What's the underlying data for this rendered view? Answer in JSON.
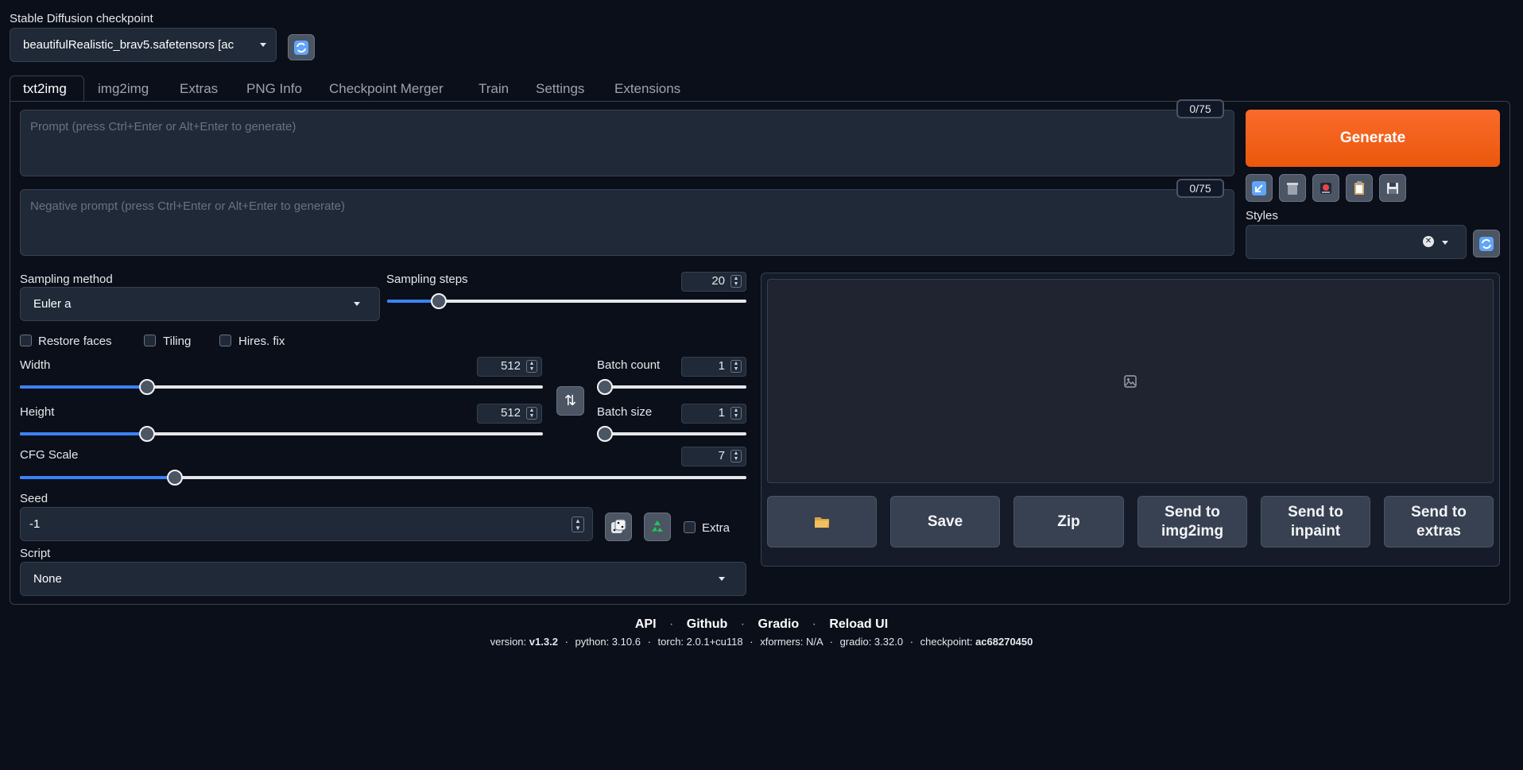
{
  "checkpoint": {
    "label": "Stable Diffusion checkpoint",
    "value": "beautifulRealistic_brav5.safetensors [ac"
  },
  "tabs": [
    "txt2img",
    "img2img",
    "Extras",
    "PNG Info",
    "Checkpoint Merger",
    "Train",
    "Settings",
    "Extensions"
  ],
  "prompt": {
    "placeholder": "Prompt (press Ctrl+Enter or Alt+Enter to generate)",
    "counter": "0/75"
  },
  "negative_prompt": {
    "placeholder": "Negative prompt (press Ctrl+Enter or Alt+Enter to generate)",
    "counter": "0/75"
  },
  "generate_label": "Generate",
  "styles_label": "Styles",
  "sampling": {
    "method_label": "Sampling method",
    "method_value": "Euler a",
    "steps_label": "Sampling steps",
    "steps_value": "20"
  },
  "checkboxes": {
    "restore_faces": "Restore faces",
    "tiling": "Tiling",
    "hires_fix": "Hires. fix",
    "extra": "Extra"
  },
  "width": {
    "label": "Width",
    "value": "512",
    "level": 0.2353
  },
  "height": {
    "label": "Height",
    "value": "512",
    "level": 0.2353
  },
  "batch_count": {
    "label": "Batch count",
    "value": "1",
    "level": 0
  },
  "batch_size": {
    "label": "Batch size",
    "value": "1",
    "level": 0
  },
  "cfg": {
    "label": "CFG Scale",
    "value": "7",
    "level": 0.2069
  },
  "steps_level": 0.1263,
  "seed": {
    "label": "Seed",
    "value": "-1"
  },
  "script": {
    "label": "Script",
    "value": "None"
  },
  "output_buttons": {
    "save": "Save",
    "zip": "Zip",
    "send_img2img": "Send to img2img",
    "send_inpaint": "Send to inpaint",
    "send_extras": "Send to extras"
  },
  "footer": {
    "links": [
      "API",
      "Github",
      "Gradio",
      "Reload UI"
    ],
    "version_label": "version:",
    "version": "v1.3.2",
    "python": "python: 3.10.6",
    "torch": "torch: 2.0.1+cu118",
    "xformers": "xformers: N/A",
    "gradio": "gradio: 3.32.0",
    "checkpoint_label": "checkpoint:",
    "checkpoint": "ac68270450"
  },
  "colors": {
    "background": "#0b0f19",
    "generate": "#f97316",
    "slider_fill": "#3b82f6"
  }
}
